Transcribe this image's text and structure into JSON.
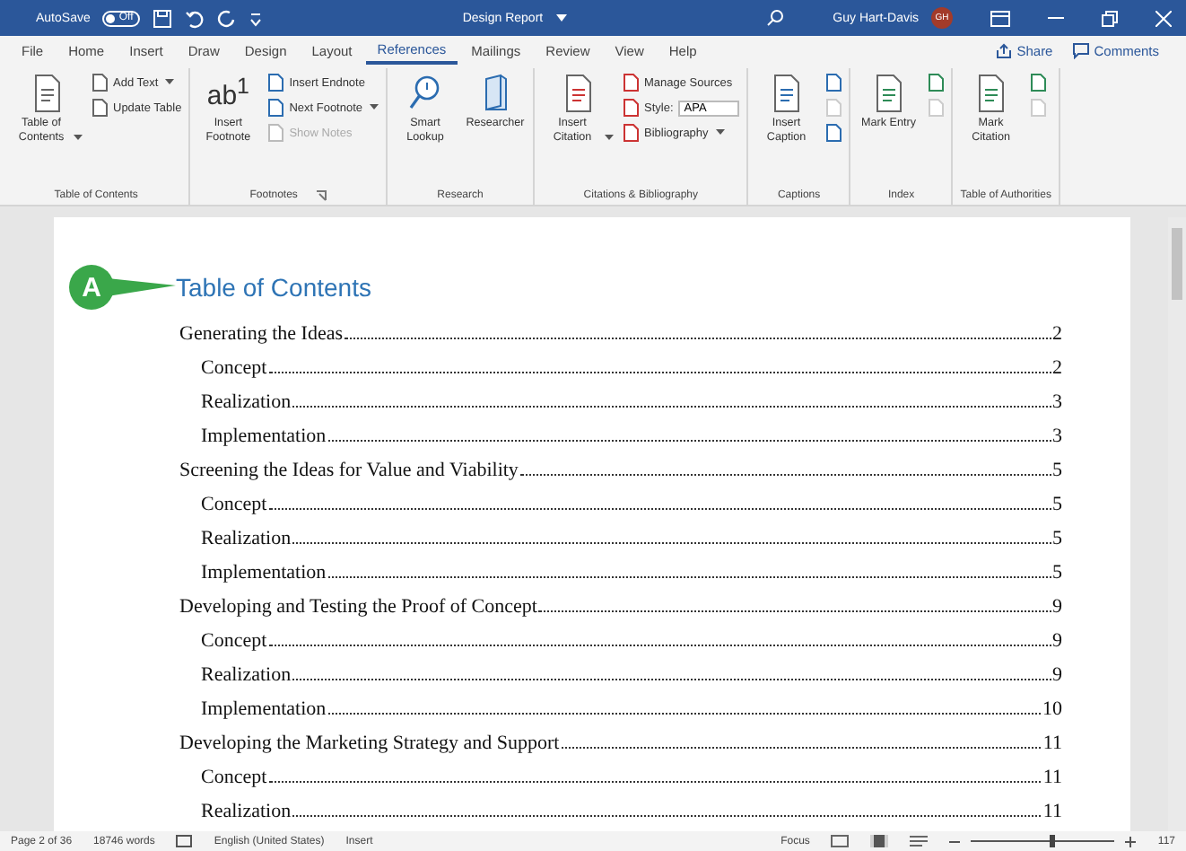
{
  "title_bar": {
    "autosave_label": "AutoSave",
    "autosave_toggle": "Off",
    "document_title": "Design Report",
    "user_name": "Guy Hart-Davis",
    "user_initials": "GH"
  },
  "tabs": [
    {
      "label": "File",
      "selected": false
    },
    {
      "label": "Home",
      "selected": false
    },
    {
      "label": "Insert",
      "selected": false
    },
    {
      "label": "Draw",
      "selected": false
    },
    {
      "label": "Design",
      "selected": false
    },
    {
      "label": "Layout",
      "selected": false
    },
    {
      "label": "References",
      "selected": true
    },
    {
      "label": "Mailings",
      "selected": false
    },
    {
      "label": "Review",
      "selected": false
    },
    {
      "label": "View",
      "selected": false
    },
    {
      "label": "Help",
      "selected": false
    }
  ],
  "tab_actions": [
    {
      "label": "Share"
    },
    {
      "label": "Comments"
    }
  ],
  "ribbon_groups": [
    {
      "label": "Table of Contents",
      "items": [
        {
          "kind": "large",
          "label": "Table of Contents",
          "dropdown": true
        },
        {
          "kind": "small",
          "label": "Add Text",
          "dropdown": true
        },
        {
          "kind": "small",
          "label": "Update Table"
        }
      ]
    },
    {
      "label": "Footnotes",
      "launcher": true,
      "items": [
        {
          "kind": "large",
          "icon_text": "ab$^{1}$",
          "label": "Insert Footnote"
        },
        {
          "kind": "small",
          "label": "Insert Endnote"
        },
        {
          "kind": "small",
          "label": "Next Footnote",
          "dropdown": true
        },
        {
          "kind": "small",
          "label": "Show Notes",
          "disabled": true
        }
      ]
    },
    {
      "label": "Research",
      "items": [
        {
          "kind": "large",
          "label": "Smart Lookup"
        },
        {
          "kind": "large",
          "label": "Researcher"
        }
      ]
    },
    {
      "label": "Citations & Bibliography",
      "items": [
        {
          "kind": "large",
          "label": "Insert Citation",
          "dropdown": true
        },
        {
          "kind": "small",
          "label": "Manage Sources"
        },
        {
          "kind": "select",
          "label": "Style:",
          "value": "APA"
        },
        {
          "kind": "small",
          "label": "Bibliography",
          "dropdown": true
        }
      ]
    },
    {
      "label": "Captions",
      "items": [
        {
          "kind": "large",
          "label": "Insert Caption"
        },
        {
          "kind": "icon"
        },
        {
          "kind": "icon",
          "disabled": true
        },
        {
          "kind": "icon"
        }
      ]
    },
    {
      "label": "Index",
      "items": [
        {
          "kind": "large",
          "label": "Mark Entry"
        },
        {
          "kind": "icon"
        },
        {
          "kind": "icon",
          "disabled": true
        }
      ]
    },
    {
      "label": "Table of Authorities",
      "items": [
        {
          "kind": "large",
          "label": "Mark Citation"
        },
        {
          "kind": "icon"
        },
        {
          "kind": "icon",
          "disabled": true
        }
      ]
    }
  ],
  "callout": "A",
  "toc": {
    "heading": "Table of Contents",
    "entries": [
      {
        "text": "Generating the Ideas",
        "page": "2",
        "children": [
          {
            "text": "Concept",
            "page": "2"
          },
          {
            "text": "Realization",
            "page": "3"
          },
          {
            "text": "Implementation",
            "page": "3"
          }
        ]
      },
      {
        "text": "Screening the Ideas for Value and Viability",
        "page": "5",
        "children": [
          {
            "text": "Concept",
            "page": "5"
          },
          {
            "text": "Realization",
            "page": "5"
          },
          {
            "text": "Implementation",
            "page": "5"
          }
        ]
      },
      {
        "text": "Developing and Testing the Proof of Concept",
        "page": "9",
        "children": [
          {
            "text": "Concept",
            "page": "9"
          },
          {
            "text": "Realization",
            "page": "9"
          },
          {
            "text": "Implementation",
            "page": "10"
          }
        ]
      },
      {
        "text": "Developing the Marketing Strategy and Support",
        "page": "11",
        "children": [
          {
            "text": "Concept",
            "page": "11"
          },
          {
            "text": "Realization",
            "page": "11"
          }
        ]
      }
    ]
  },
  "status_bar": {
    "page": "Page 2 of 36",
    "words": "18746 words",
    "language": "English (United States)",
    "mode": "Insert",
    "focus": "Focus",
    "zoom_slider": {
      "level": 0.55
    },
    "zoom": "117"
  }
}
